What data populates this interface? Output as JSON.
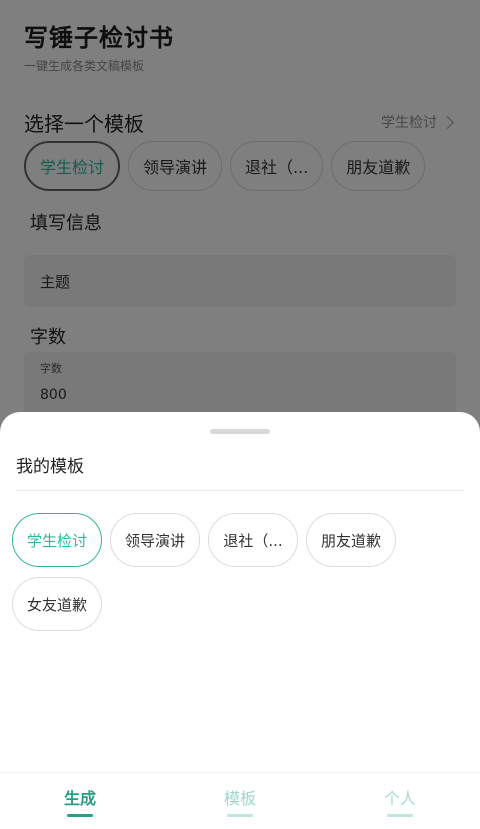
{
  "header": {
    "title": "写锤子检讨书",
    "subtitle": "一键生成各类文稿模板"
  },
  "template_section": {
    "title": "选择一个模板",
    "current": "学生检讨",
    "chips": [
      "学生检讨",
      "领导演讲",
      "退社（...",
      "朋友道歉"
    ],
    "active_index": 0
  },
  "form": {
    "info_label": "填写信息",
    "topic_placeholder": "主题",
    "words_label": "字数",
    "words_field_label": "字数",
    "words_value": "800"
  },
  "sheet": {
    "title": "我的模板",
    "templates": [
      "学生检讨",
      "领导演讲",
      "退社（...",
      "朋友道歉",
      "女友道歉"
    ],
    "selected_index": 0
  },
  "bottom_nav": {
    "generate": "生成",
    "templates": "模板",
    "profile": "个人"
  },
  "colors": {
    "accent": "#2fb99b",
    "overlay": "rgba(0,0,0,0.5)"
  }
}
